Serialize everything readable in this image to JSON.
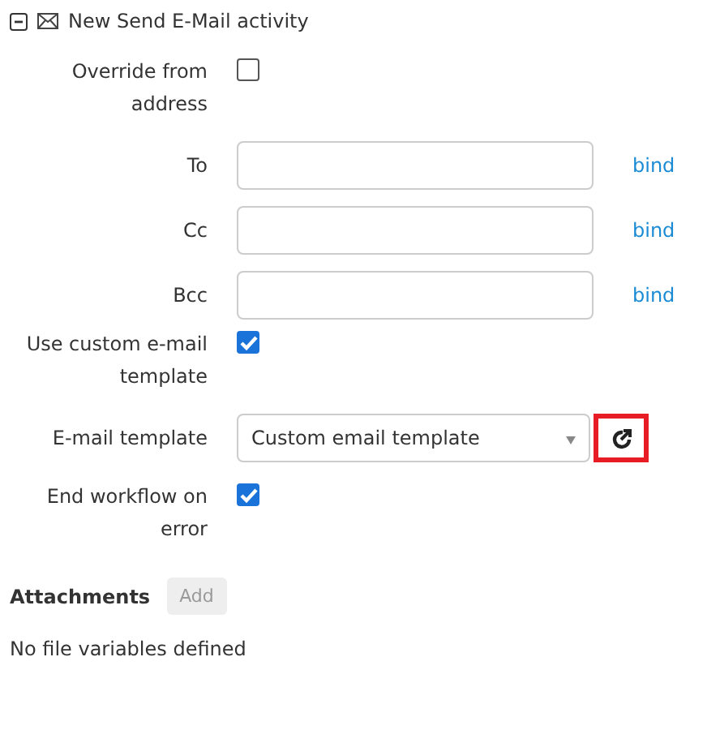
{
  "header": {
    "title": "New Send E-Mail activity",
    "expanded": true
  },
  "fields": [
    {
      "kind": "checkbox",
      "label": "Override from address",
      "checked": false
    },
    {
      "kind": "text",
      "label": "To",
      "link": "bind"
    },
    {
      "kind": "text",
      "label": "Cc",
      "link": "bind"
    },
    {
      "kind": "text",
      "label": "Bcc",
      "link": "bind"
    },
    {
      "kind": "checkbox",
      "label": "Use custom e-mail template",
      "checked": true
    },
    {
      "kind": "select",
      "label": "E-mail template",
      "value": "Custom email template",
      "button_highlighted": true
    },
    {
      "kind": "checkbox",
      "label": "End workflow on error",
      "checked": true
    }
  ],
  "attachments": {
    "title": "Attachments",
    "button": "Add",
    "empty_text": "No file variables defined"
  }
}
